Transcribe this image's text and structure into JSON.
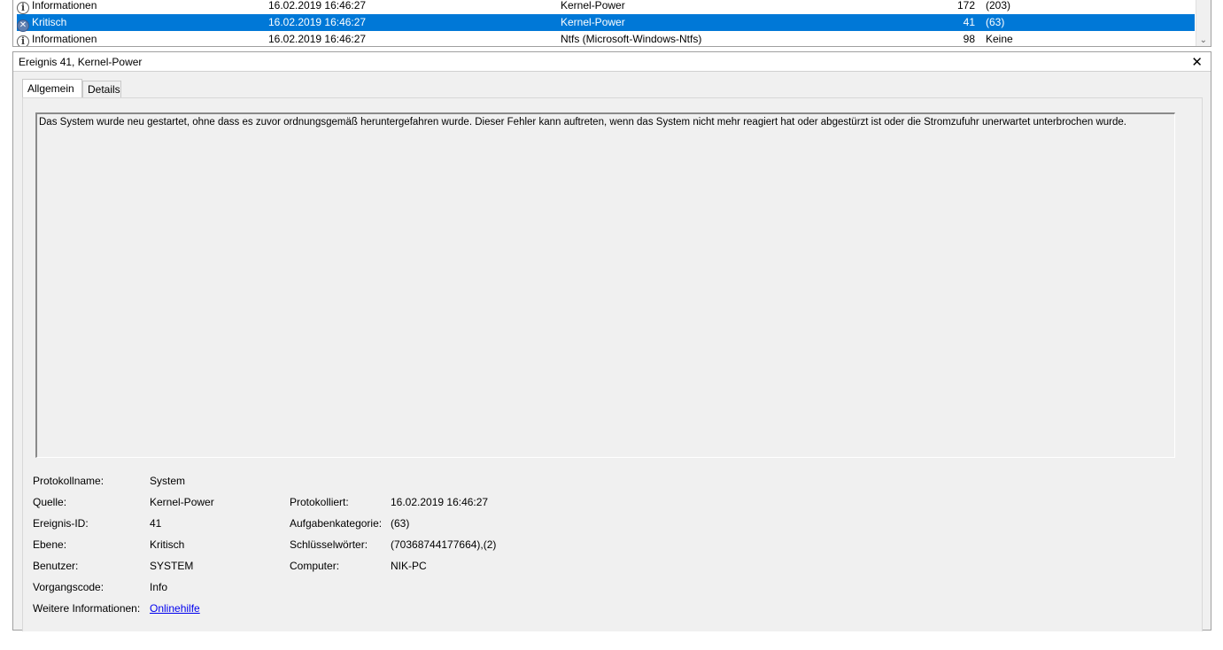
{
  "event_list": {
    "rows": [
      {
        "level": "Informationen",
        "level_icon": "info-icon",
        "date": "16.02.2019 16:46:27",
        "source": "Kernel-Power",
        "event_id": "172",
        "task": "(203)",
        "selected": false
      },
      {
        "level": "Kritisch",
        "level_icon": "critical-icon",
        "date": "16.02.2019 16:46:27",
        "source": "Kernel-Power",
        "event_id": "41",
        "task": "(63)",
        "selected": true
      },
      {
        "level": "Informationen",
        "level_icon": "info-icon",
        "date": "16.02.2019 16:46:27",
        "source": "Ntfs (Microsoft-Windows-Ntfs)",
        "event_id": "98",
        "task": "Keine",
        "selected": false
      }
    ],
    "scroll_down_glyph": "⌄"
  },
  "detail": {
    "title": "Ereignis 41, Kernel-Power",
    "close_glyph": "✕",
    "tabs": [
      {
        "label": "Allgemein",
        "active": true
      },
      {
        "label": "Details",
        "active": false
      }
    ],
    "description": "Das System wurde neu gestartet, ohne dass es zuvor ordnungsgemäß heruntergefahren wurde. Dieser Fehler kann auftreten, wenn das System nicht mehr reagiert hat oder abgestürzt ist oder die Stromzufuhr unerwartet unterbrochen wurde.",
    "props": {
      "log_name_label": "Protokollname:",
      "log_name": "System",
      "source_label": "Quelle:",
      "source": "Kernel-Power",
      "logged_label": "Protokolliert:",
      "logged": "16.02.2019 16:46:27",
      "event_id_label": "Ereignis-ID:",
      "event_id": "41",
      "task_label": "Aufgabenkategorie:",
      "task": "(63)",
      "level_label": "Ebene:",
      "level": "Kritisch",
      "keywords_label": "Schlüsselwörter:",
      "keywords": "(70368744177664),(2)",
      "user_label": "Benutzer:",
      "user": "SYSTEM",
      "computer_label": "Computer:",
      "computer": "NIK-PC",
      "opcode_label": "Vorgangscode:",
      "opcode": "Info",
      "more_info_label": "Weitere Informationen:",
      "more_info_link": "Onlinehilfe"
    }
  },
  "colors": {
    "selection": "#0078d7",
    "link": "#0000ee",
    "pane_bg": "#f0f0f0"
  }
}
